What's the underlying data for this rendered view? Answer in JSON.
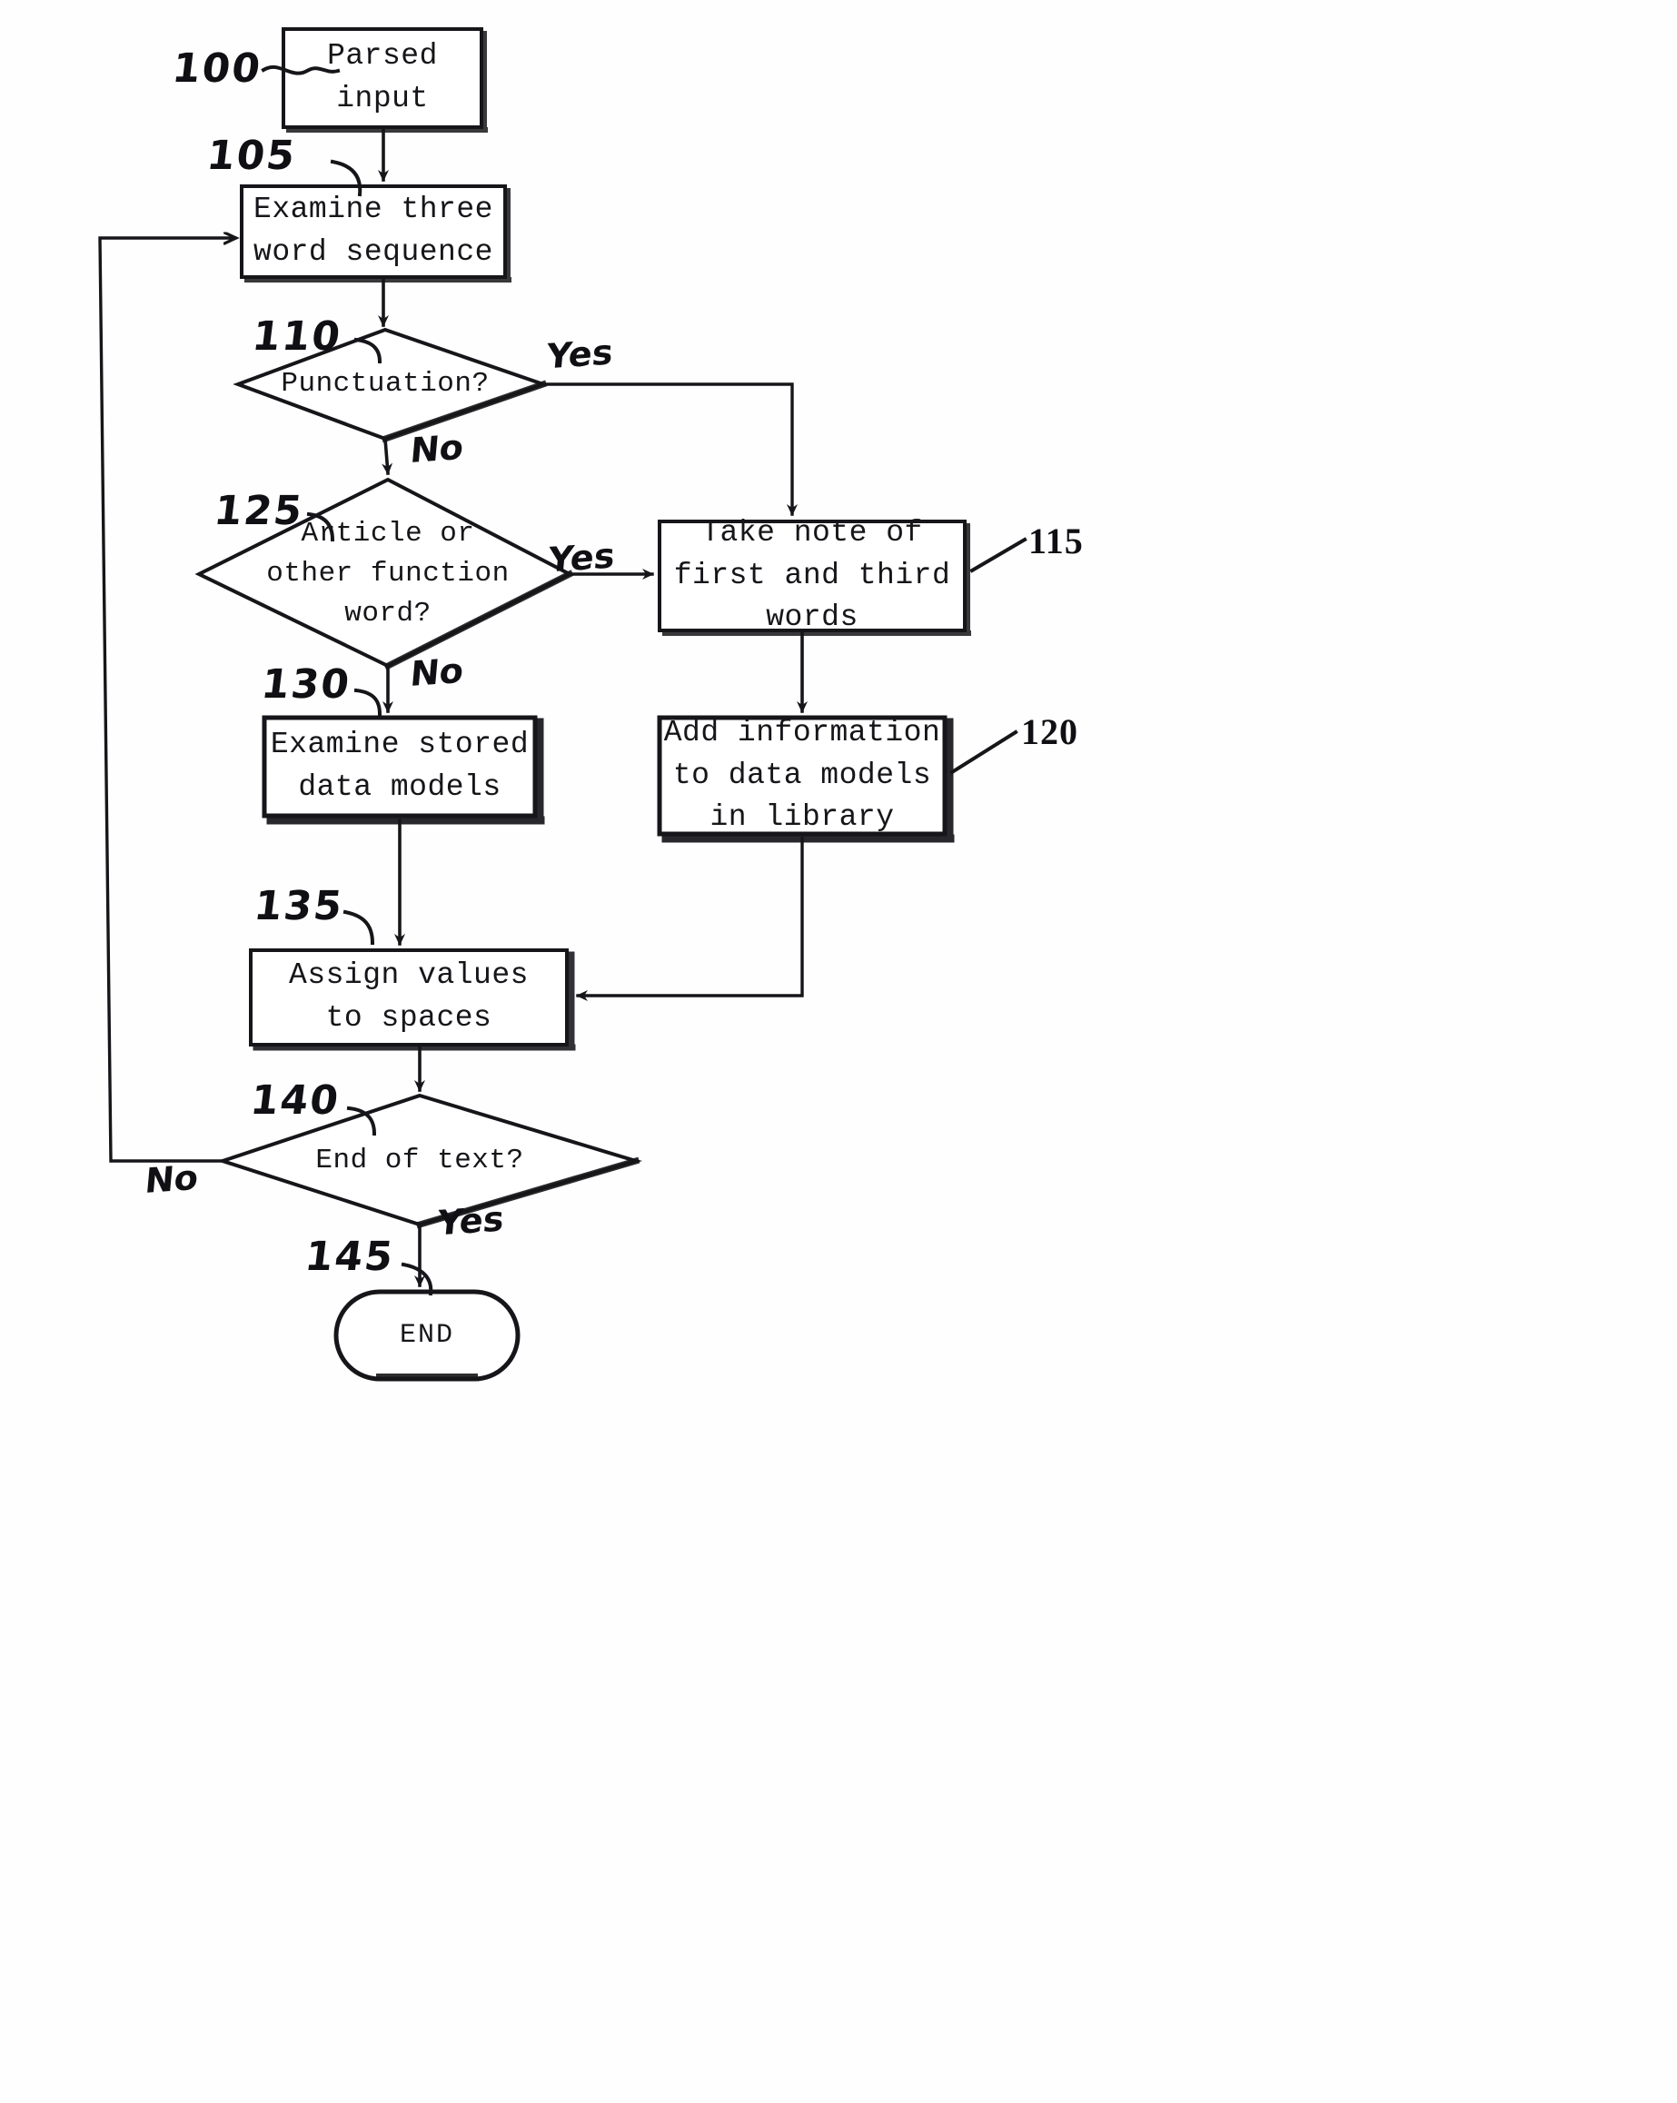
{
  "figure": {
    "type": "flowchart",
    "style": "patent-drawing",
    "background": "#ffffff",
    "ink_color": "#16161a"
  },
  "nodes": [
    {
      "id": "parsed_input",
      "ref": "100",
      "shape": "process",
      "label": "Parsed\ninput"
    },
    {
      "id": "examine_three_word",
      "ref": "105",
      "shape": "process",
      "label": "Examine three\nword sequence"
    },
    {
      "id": "punctuation",
      "ref": "110",
      "shape": "decision",
      "label": "Punctuation?"
    },
    {
      "id": "take_note",
      "ref": "115",
      "shape": "process",
      "label": "Take note of\nfirst and third\nwords"
    },
    {
      "id": "add_information",
      "ref": "120",
      "shape": "process",
      "label": "Add information\nto data models\nin library"
    },
    {
      "id": "article_or_function",
      "ref": "125",
      "shape": "decision",
      "label": "Article or\nother function\nword?"
    },
    {
      "id": "examine_stored",
      "ref": "130",
      "shape": "process",
      "label": "Examine stored\ndata models"
    },
    {
      "id": "assign_values",
      "ref": "135",
      "shape": "process",
      "label": "Assign values\nto spaces"
    },
    {
      "id": "end_of_text",
      "ref": "140",
      "shape": "decision",
      "label": "End of text?"
    },
    {
      "id": "end_terminator",
      "ref": "145",
      "shape": "terminator",
      "label": "END"
    }
  ],
  "edge_labels": {
    "punctuation_yes": "Yes",
    "punctuation_no": "No",
    "article_yes": "Yes",
    "article_no": "No",
    "end_of_text_no": "No",
    "end_of_text_yes": "Yes"
  },
  "ref_numbers": {
    "n100": "100",
    "n105": "105",
    "n110": "110",
    "n115": "115",
    "n120": "120",
    "n125": "125",
    "n130": "130",
    "n135": "135",
    "n140": "140",
    "n145": "145"
  }
}
